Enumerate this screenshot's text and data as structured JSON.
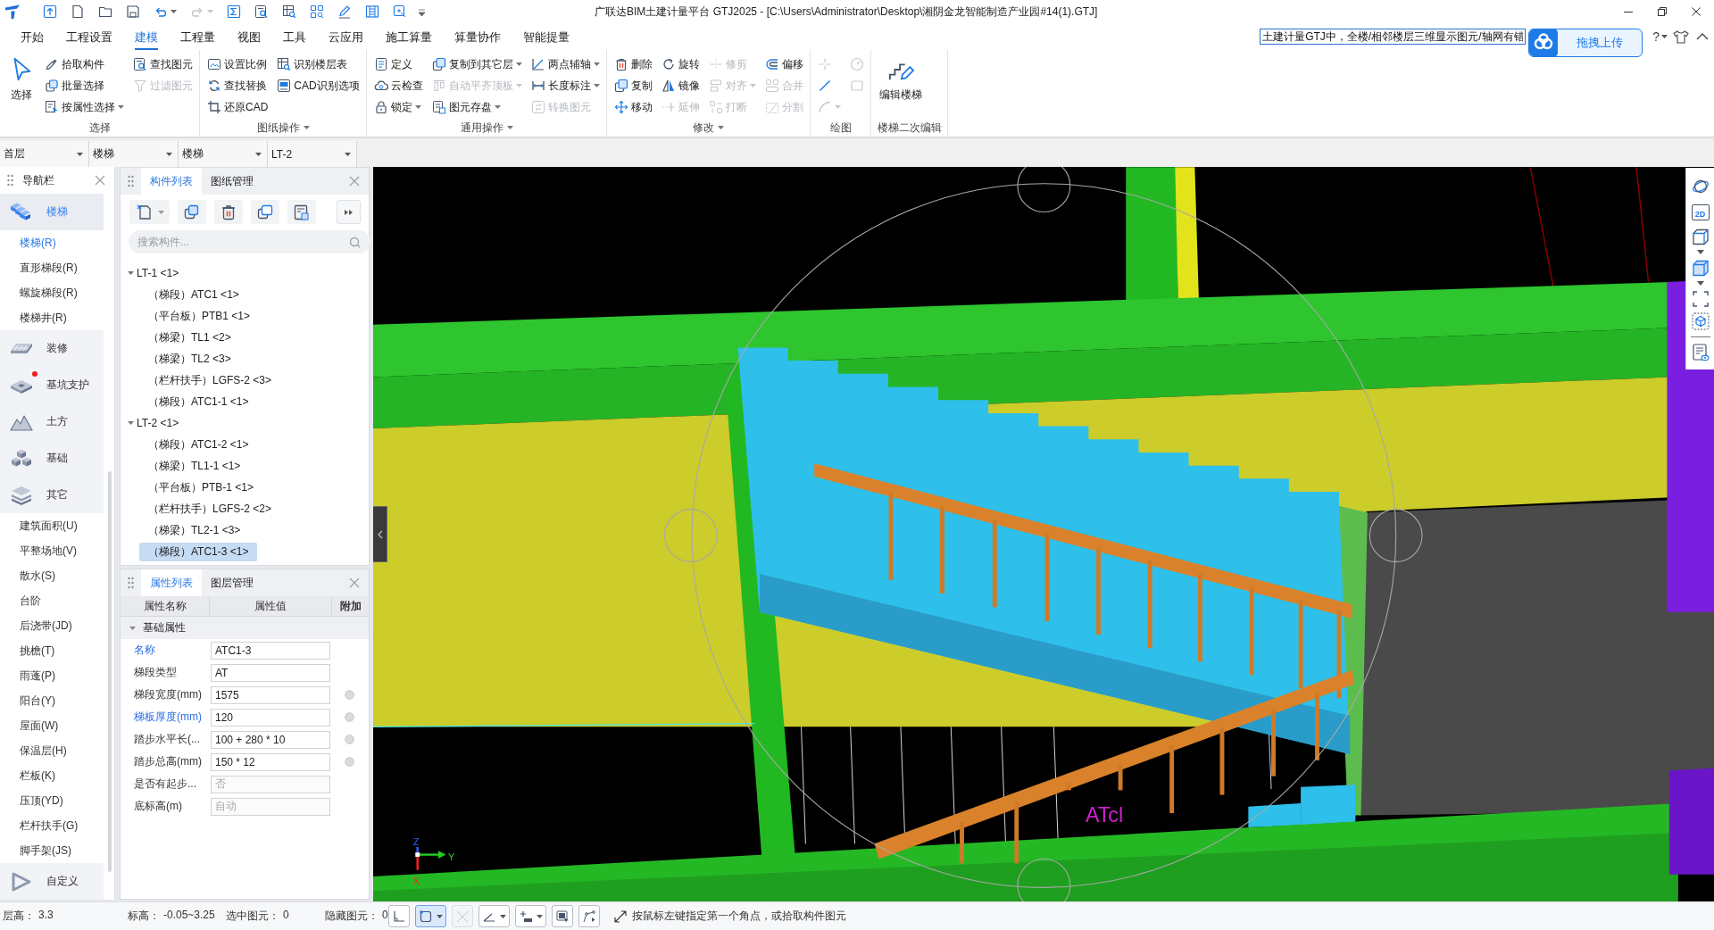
{
  "title_bar": {
    "quick_access": [
      {
        "disabled": false,
        "dropdown": false
      },
      {
        "disabled": false,
        "dropdown": false
      },
      {
        "disabled": false,
        "dropdown": false
      },
      {
        "disabled": false,
        "dropdown": false
      },
      {
        "disabled": false,
        "dropdown": true
      },
      {
        "disabled": true,
        "dropdown": true
      },
      {
        "disabled": false,
        "dropdown": false
      },
      {
        "disabled": false,
        "dropdown": false
      },
      {
        "disabled": false,
        "dropdown": false
      },
      {
        "disabled": false,
        "dropdown": false
      },
      {
        "disabled": false,
        "dropdown": false
      },
      {
        "disabled": false,
        "dropdown": false
      },
      {
        "disabled": false,
        "dropdown": false
      }
    ],
    "title": "广联达BIM土建计量平台 GTJ2025 - [C:\\Users\\Administrator\\Desktop\\湘阴金龙智能制造产业园#14(1).GTJ]"
  },
  "menu_tabs": [
    {
      "label": "开始",
      "selected": false
    },
    {
      "label": "工程设置",
      "selected": false
    },
    {
      "label": "建模",
      "selected": true
    },
    {
      "label": "工程量",
      "selected": false
    },
    {
      "label": "视图",
      "selected": false
    },
    {
      "label": "工具",
      "selected": false
    },
    {
      "label": "云应用",
      "selected": false
    },
    {
      "label": "施工算量",
      "selected": false
    },
    {
      "label": "算量协作",
      "selected": false
    },
    {
      "label": "智能提量",
      "selected": false
    }
  ],
  "help_search": {
    "value": "土建计量GTJ中，全楼/相邻楼层三维显示图元/轴网有错"
  },
  "upload_widget": {
    "label": "拖拽上传"
  },
  "help_label": "?",
  "ribbon": [
    {
      "label": "选择",
      "dropdown": false,
      "columns": [
        [
          {
            "kind": "large",
            "label": "选择",
            "disabled": false,
            "dropdown": false
          }
        ],
        [
          {
            "kind": "small",
            "label": "拾取构件",
            "disabled": false,
            "dropdown": false
          },
          {
            "kind": "small",
            "label": "批量选择",
            "disabled": false,
            "dropdown": false
          },
          {
            "kind": "small",
            "label": "按属性选择",
            "disabled": false,
            "dropdown": true
          }
        ],
        [
          {
            "kind": "small",
            "label": "查找图元",
            "disabled": false,
            "dropdown": false
          },
          {
            "kind": "small",
            "label": "过滤图元",
            "disabled": true,
            "dropdown": false
          }
        ]
      ]
    },
    {
      "label": "图纸操作",
      "dropdown": true,
      "columns": [
        [
          {
            "kind": "small",
            "label": "设置比例",
            "disabled": false,
            "dropdown": false
          },
          {
            "kind": "small",
            "label": "查找替换",
            "disabled": false,
            "dropdown": false
          },
          {
            "kind": "small",
            "label": "还原CAD",
            "disabled": false,
            "dropdown": false
          }
        ],
        [
          {
            "kind": "small",
            "label": "识别楼层表",
            "disabled": false,
            "dropdown": false
          },
          {
            "kind": "small",
            "label": "CAD识别选项",
            "disabled": false,
            "dropdown": false
          }
        ]
      ]
    },
    {
      "label": "通用操作",
      "dropdown": true,
      "columns": [
        [
          {
            "kind": "small",
            "label": "定义",
            "disabled": false,
            "dropdown": false
          },
          {
            "kind": "small",
            "label": "云检查",
            "disabled": false,
            "dropdown": false
          },
          {
            "kind": "small",
            "label": "锁定",
            "disabled": false,
            "dropdown": true
          }
        ],
        [
          {
            "kind": "small",
            "label": "复制到其它层",
            "disabled": false,
            "dropdown": true
          },
          {
            "kind": "small",
            "label": "自动平齐顶板",
            "disabled": true,
            "dropdown": true
          },
          {
            "kind": "small",
            "label": "图元存盘",
            "disabled": false,
            "dropdown": true
          }
        ],
        [
          {
            "kind": "small",
            "label": "两点辅轴",
            "disabled": false,
            "dropdown": true
          },
          {
            "kind": "small",
            "label": "长度标注",
            "disabled": false,
            "dropdown": true
          },
          {
            "kind": "small",
            "label": "转换图元",
            "disabled": true,
            "dropdown": false
          }
        ]
      ]
    },
    {
      "label": "修改",
      "dropdown": true,
      "columns": [
        [
          {
            "kind": "small",
            "label": "删除",
            "disabled": false,
            "dropdown": false
          },
          {
            "kind": "small",
            "label": "复制",
            "disabled": false,
            "dropdown": false
          },
          {
            "kind": "small",
            "label": "移动",
            "disabled": false,
            "dropdown": false
          }
        ],
        [
          {
            "kind": "small",
            "label": "旋转",
            "disabled": false,
            "dropdown": false
          },
          {
            "kind": "small",
            "label": "镜像",
            "disabled": false,
            "dropdown": false
          },
          {
            "kind": "small",
            "label": "延伸",
            "disabled": true,
            "dropdown": false
          }
        ],
        [
          {
            "kind": "small",
            "label": "修剪",
            "disabled": true,
            "dropdown": false
          },
          {
            "kind": "small",
            "label": "对齐",
            "disabled": true,
            "dropdown": true
          },
          {
            "kind": "small",
            "label": "打断",
            "disabled": true,
            "dropdown": false
          }
        ],
        [
          {
            "kind": "small",
            "label": "偏移",
            "disabled": false,
            "dropdown": false
          },
          {
            "kind": "small",
            "label": "合并",
            "disabled": true,
            "dropdown": false
          },
          {
            "kind": "small",
            "label": "分割",
            "disabled": true,
            "dropdown": false
          }
        ]
      ]
    },
    {
      "label": "绘图",
      "dropdown": false,
      "columns": [
        [
          {
            "kind": "icon",
            "disabled": true,
            "dropdown": false
          },
          {
            "kind": "icon",
            "disabled": false,
            "dropdown": false
          },
          {
            "kind": "icon",
            "disabled": true,
            "dropdown": true
          }
        ],
        [
          {
            "kind": "icon",
            "disabled": true,
            "dropdown": false
          },
          {
            "kind": "icon",
            "disabled": true,
            "dropdown": false
          }
        ]
      ]
    },
    {
      "label": "楼梯二次编辑",
      "dropdown": false,
      "columns": [
        [
          {
            "kind": "large",
            "label": "编辑楼梯",
            "disabled": false,
            "dropdown": false
          }
        ]
      ]
    }
  ],
  "selectors": [
    "首层",
    "楼梯",
    "楼梯",
    "LT-2"
  ],
  "navigation": {
    "title": "导航栏",
    "sections": [
      {
        "label": "楼梯",
        "selected": true,
        "notice": false,
        "children": [
          {
            "label": "楼梯(R)",
            "selected": true
          },
          {
            "label": "直形梯段(R)",
            "selected": false
          },
          {
            "label": "螺旋梯段(R)",
            "selected": false
          },
          {
            "label": "楼梯井(R)",
            "selected": false
          }
        ]
      },
      {
        "label": "装修",
        "selected": false,
        "notice": false
      },
      {
        "label": "基坑支护",
        "selected": false,
        "notice": true
      },
      {
        "label": "土方",
        "selected": false,
        "notice": false
      },
      {
        "label": "基础",
        "selected": false,
        "notice": false
      },
      {
        "label": "其它",
        "selected": false,
        "notice": false,
        "children": [
          {
            "label": "建筑面积(U)",
            "selected": false
          },
          {
            "label": "平整场地(V)",
            "selected": false
          },
          {
            "label": "散水(S)",
            "selected": false
          },
          {
            "label": "台阶",
            "selected": false
          },
          {
            "label": "后浇带(JD)",
            "selected": false
          },
          {
            "label": "挑檐(T)",
            "selected": false
          },
          {
            "label": "雨蓬(P)",
            "selected": false
          },
          {
            "label": "阳台(Y)",
            "selected": false
          },
          {
            "label": "屋面(W)",
            "selected": false
          },
          {
            "label": "保温层(H)",
            "selected": false
          },
          {
            "label": "栏板(K)",
            "selected": false
          },
          {
            "label": "压顶(YD)",
            "selected": false
          },
          {
            "label": "栏杆扶手(G)",
            "selected": false
          },
          {
            "label": "脚手架(JS)",
            "selected": false
          }
        ]
      },
      {
        "label": "自定义",
        "selected": false,
        "notice": false
      }
    ]
  },
  "component_list": {
    "tabs": [
      {
        "label": "构件列表",
        "selected": true
      },
      {
        "label": "图纸管理",
        "selected": false
      }
    ],
    "search": {
      "placeholder": "搜索构件..."
    },
    "tree": [
      {
        "label": "LT-1 <1>",
        "expanded": true,
        "selected": false,
        "children": [
          {
            "label": "（梯段）ATC1 <1>",
            "selected": false
          },
          {
            "label": "（平台板）PTB1 <1>",
            "selected": false
          },
          {
            "label": "（梯梁）TL1 <2>",
            "selected": false
          },
          {
            "label": "（梯梁）TL2 <3>",
            "selected": false
          },
          {
            "label": "（栏杆扶手）LGFS-2 <3>",
            "selected": false
          },
          {
            "label": "（梯段）ATC1-1 <1>",
            "selected": false
          }
        ]
      },
      {
        "label": "LT-2 <1>",
        "expanded": true,
        "selected": false,
        "children": [
          {
            "label": "（梯段）ATC1-2 <1>",
            "selected": false
          },
          {
            "label": "（梯梁）TL1-1 <1>",
            "selected": false
          },
          {
            "label": "（平台板）PTB-1 <1>",
            "selected": false
          },
          {
            "label": "（栏杆扶手）LGFS-2 <2>",
            "selected": false
          },
          {
            "label": "（梯梁）TL2-1 <3>",
            "selected": false
          },
          {
            "label": "（梯段）ATC1-3 <1>",
            "selected": true
          }
        ]
      }
    ]
  },
  "properties": {
    "tabs": [
      {
        "label": "属性列表",
        "selected": true
      },
      {
        "label": "图层管理",
        "selected": false
      }
    ],
    "columns": [
      "属性名称",
      "属性值",
      "附加"
    ],
    "groups": [
      {
        "label": "基础属性",
        "expanded": true,
        "rows": [
          {
            "name": "名称",
            "value": "ATC1-3",
            "public": true,
            "disabled": false
          },
          {
            "name": "梯段类型",
            "value": "AT",
            "public": false,
            "disabled": false
          },
          {
            "name": "梯段宽度(mm)",
            "value": "1575",
            "public": false,
            "disabled": false,
            "attached": false
          },
          {
            "name": "梯板厚度(mm)",
            "value": "120",
            "public": true,
            "disabled": false,
            "attached": false
          },
          {
            "name": "踏步水平长(...",
            "value": "100 + 280 * 10",
            "public": false,
            "disabled": false,
            "attached": false
          },
          {
            "name": "踏步总高(mm)",
            "value": "150 * 12",
            "public": false,
            "disabled": false,
            "attached": false
          },
          {
            "name": "是否有起步...",
            "value": "否",
            "public": false,
            "disabled": true
          },
          {
            "name": "底标高(m)",
            "value": "自动",
            "public": false,
            "disabled": true
          }
        ]
      }
    ]
  },
  "viewport": {
    "label": "ATcl",
    "axes": [
      "Z",
      "Y",
      "X"
    ],
    "view_button_label": "2D"
  },
  "status_bar": {
    "fields": [
      {
        "label": "层高：",
        "value": "3.3"
      },
      {
        "label": "标高：",
        "value": "-0.05~3.25"
      },
      {
        "label": "选中图元：",
        "value": "0"
      },
      {
        "label": "隐藏图元：",
        "value": "0"
      }
    ],
    "tools": [
      {
        "selected": false,
        "disabled": false,
        "dropdown": false
      },
      {
        "selected": true,
        "disabled": false,
        "dropdown": true
      },
      {
        "selected": false,
        "disabled": true,
        "dropdown": false
      },
      {
        "selected": false,
        "disabled": false,
        "dropdown": true
      },
      {
        "selected": false,
        "disabled": false,
        "dropdown": true
      },
      {
        "selected": false,
        "disabled": false,
        "dropdown": false
      },
      {
        "selected": false,
        "disabled": false,
        "dropdown": false
      }
    ],
    "hint": "按鼠标左键指定第一个角点，或拾取构件图元"
  }
}
